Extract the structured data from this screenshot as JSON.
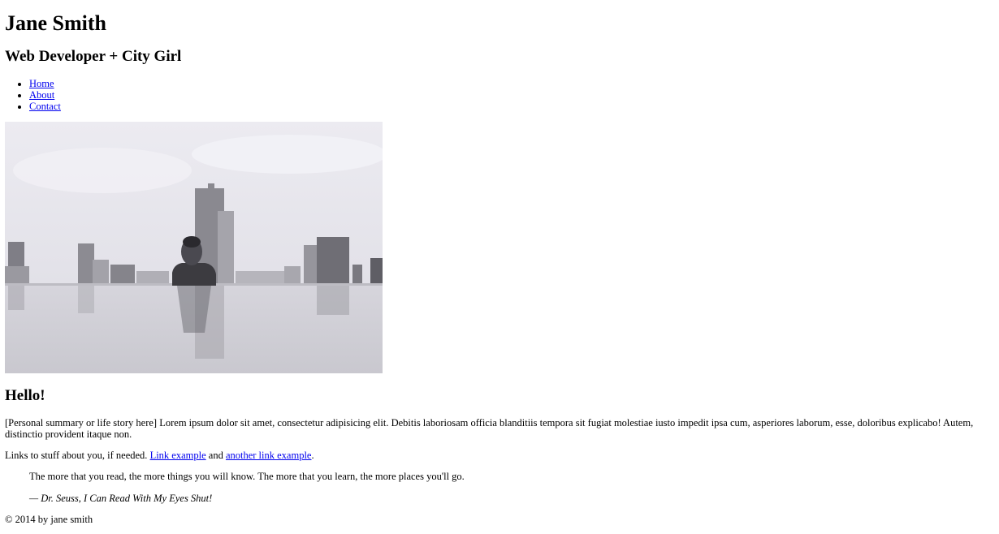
{
  "header": {
    "name": "Jane Smith",
    "tagline": "Web Developer + City Girl"
  },
  "nav": {
    "items": [
      {
        "label": "Home"
      },
      {
        "label": "About"
      },
      {
        "label": "Contact"
      }
    ]
  },
  "hero_image": {
    "subject": "black-and-white photo of a woman in an infinity pool with city skyline",
    "colors": {
      "sky": "#e6e5ec",
      "building": "#8f8e95",
      "water": "#d2d1d8"
    }
  },
  "main": {
    "heading": "Hello!",
    "summary": "[Personal summary or life story here] Lorem ipsum dolor sit amet, consectetur adipisicing elit. Debitis laboriosam officia blanditiis tempora sit fugiat molestiae iusto impedit ipsa cum, asperiores laborum, esse, doloribus explicabo! Autem, distinctio provident itaque non.",
    "links_prefix": "Links to stuff about you, if needed. ",
    "link1": "Link example",
    "links_middle": " and ",
    "link2": "another link example",
    "links_suffix": "."
  },
  "quote": {
    "text": "The more that you read, the more things you will know. The more that you learn, the more places you'll go.",
    "citation": "— Dr. Seuss, I Can Read With My Eyes Shut!"
  },
  "footer": {
    "text": "© 2014 by jane smith"
  },
  "colors": {
    "link": "#0000ee",
    "text": "#000000",
    "background": "#ffffff"
  }
}
